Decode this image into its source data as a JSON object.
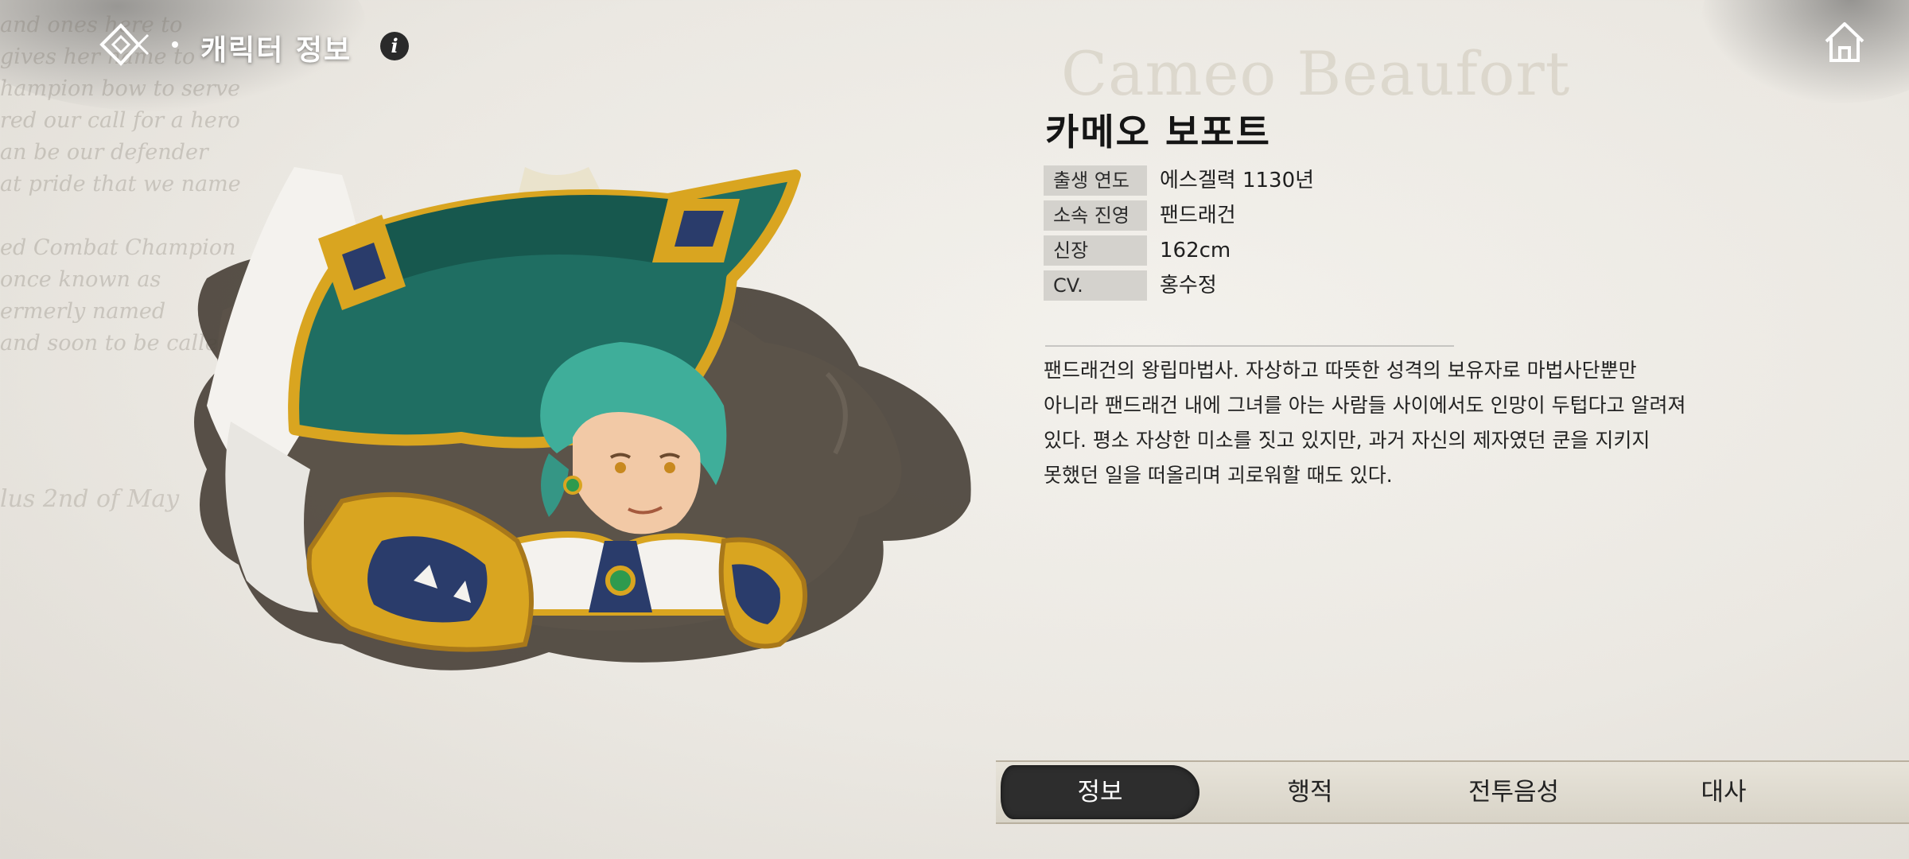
{
  "header": {
    "title": "캐릭터 정보",
    "info_icon": "i"
  },
  "background_script": [
    "and ones here to",
    "gives her name to",
    "hampion bow to serve",
    "red our call for a hero",
    "an be our defender",
    "at pride that we name",
    "",
    "ed Combat Champion",
    "once known as",
    "ermerly named",
    "and soon to be called"
  ],
  "background_date": "lus 2nd of May",
  "character": {
    "name_en": "Cameo Beaufort",
    "name_ko": "카메오 보포트",
    "stats": [
      {
        "label": "출생 연도",
        "value": "에스겔력 1130년"
      },
      {
        "label": "소속 진영",
        "value": "팬드래건"
      },
      {
        "label": "신장",
        "value": "162cm"
      },
      {
        "label": "CV.",
        "value": "홍수정"
      }
    ],
    "description_lines": [
      "팬드래건의 왕립마법사. 자상하고 따뜻한 성격의 보유자로 마법사단뿐만",
      "아니라 팬드래건 내에 그녀를 아는 사람들 사이에서도 인망이 두텁다고 알려져",
      "있다. 평소 자상한 미소를 짓고 있지만, 과거 자신의 제자였던 쿤을 지키지",
      "못했던 일을 떠올리며 괴로워할 때도 있다."
    ]
  },
  "tabs": [
    {
      "label": "정보",
      "active": true
    },
    {
      "label": "행적",
      "active": false
    },
    {
      "label": "전투음성",
      "active": false
    },
    {
      "label": "대사",
      "active": false
    }
  ],
  "colors": {
    "hat_teal": "#1f6e62",
    "gold": "#d9a520",
    "hair": "#3fae9a",
    "ink": "#3a342d",
    "active_tab": "#2d2d2d"
  }
}
